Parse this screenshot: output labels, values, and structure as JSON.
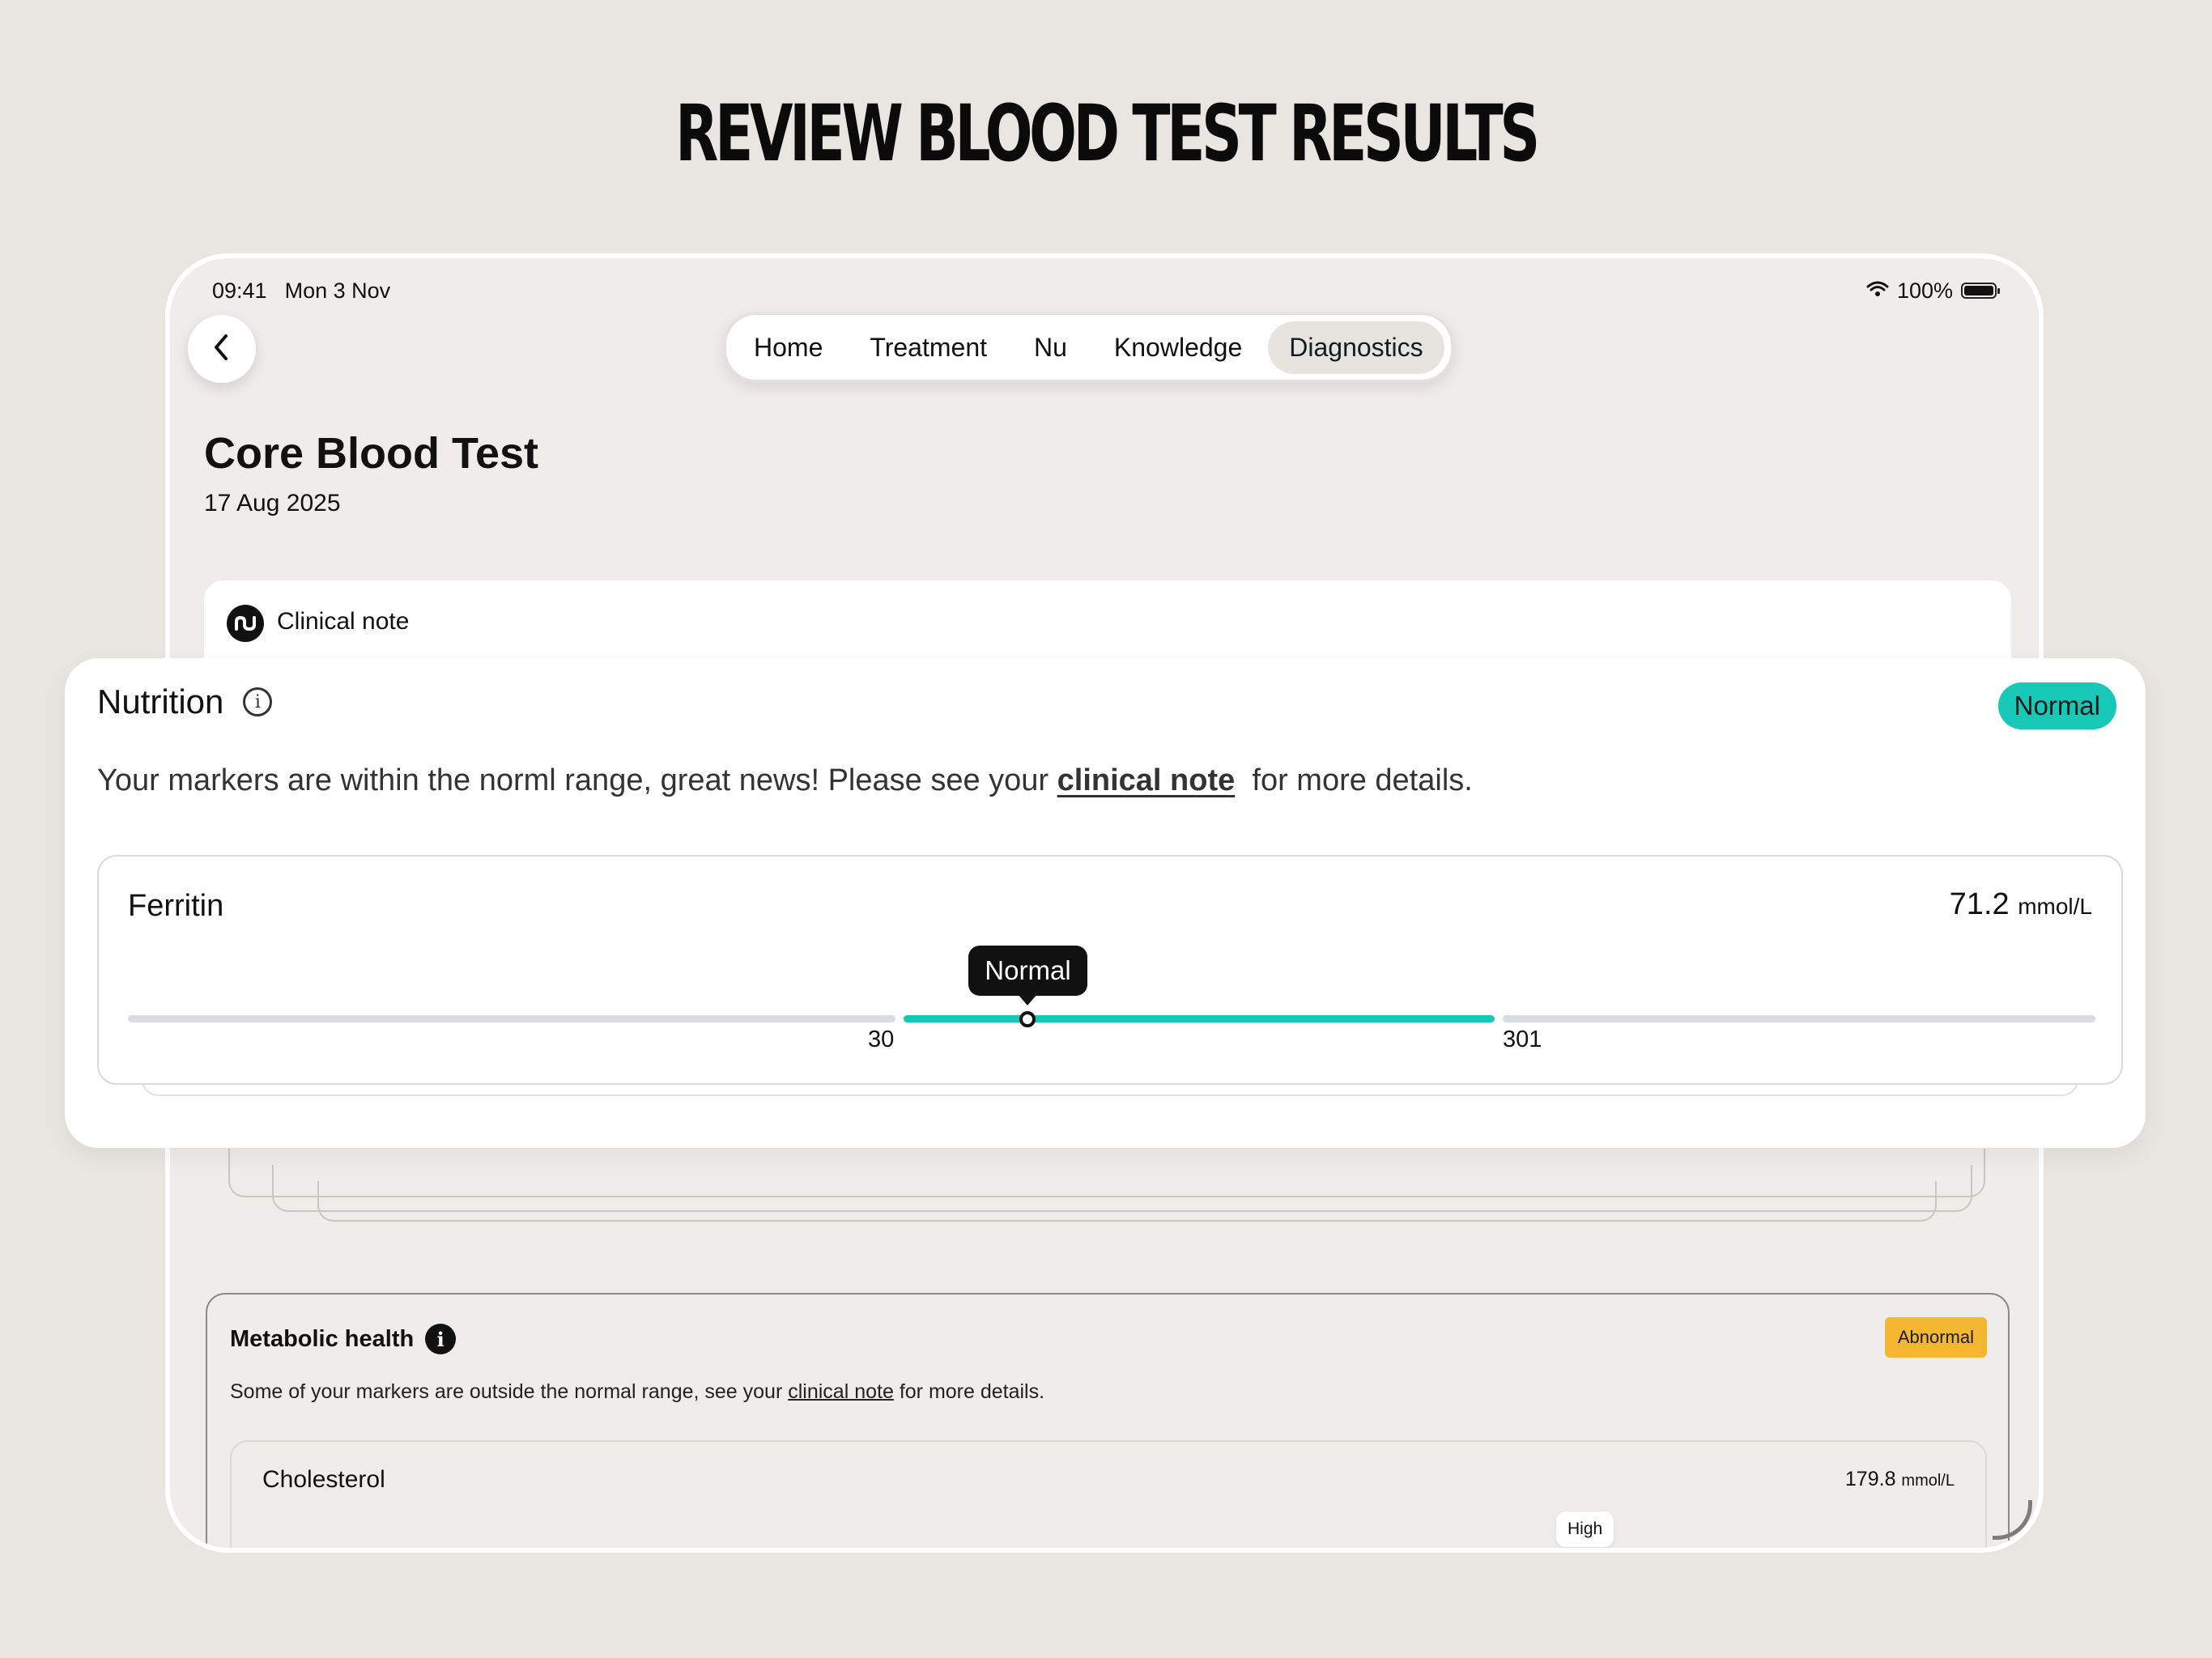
{
  "headline": "REVIEW BLOOD TEST RESULTS",
  "status_bar": {
    "time": "09:41",
    "date": "Mon 3 Nov",
    "battery": "100%"
  },
  "nav": {
    "tabs": [
      {
        "label": "Home",
        "active": false
      },
      {
        "label": "Treatment",
        "active": false
      },
      {
        "label": "Nu",
        "active": false
      },
      {
        "label": "Knowledge",
        "active": false
      },
      {
        "label": "Diagnostics",
        "active": true
      }
    ]
  },
  "page": {
    "title": "Core Blood Test",
    "date": "17 Aug 2025"
  },
  "clinical_note": {
    "label": "Clinical note"
  },
  "nutrition": {
    "title": "Nutrition",
    "status": "Normal",
    "description_before": "Your markers are within the norml range, great news! Please see your ",
    "description_link": "clinical note",
    "description_after": "  for more details.",
    "marker": {
      "name": "Ferritin",
      "value": "71.2",
      "unit": "mmol/L",
      "status": "Normal",
      "range_low": "30",
      "range_high": "301",
      "value_fraction_of_normal_range": 0.21,
      "colors": {
        "normal_range": "#17c8b6",
        "out_of_range": "#d8dbe1"
      }
    }
  },
  "metabolic": {
    "title": "Metabolic health",
    "status": "Abnormal",
    "description_before": "Some of your markers are outside the normal range, see your ",
    "description_link": "clinical note",
    "description_after": " for more details.",
    "marker": {
      "name": "Cholesterol",
      "value": "179.8",
      "unit": "mmol/L",
      "status": "High"
    }
  },
  "colors": {
    "normal": "#17c8b6",
    "abnormal": "#f5b731",
    "background": "#e9e6e2"
  },
  "icons": {
    "back": "chevron-left-icon",
    "wifi": "wifi-icon",
    "battery": "battery-icon",
    "info": "info-icon",
    "logo": "nu-logo-icon"
  }
}
